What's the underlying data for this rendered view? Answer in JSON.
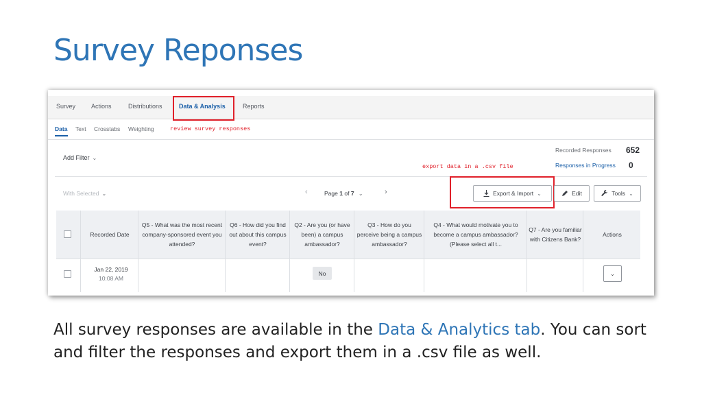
{
  "slide": {
    "title": "Survey Reponses",
    "caption_part1": "All survey responses are available in the ",
    "caption_link": "Data & Analytics tab",
    "caption_part2": ". You can sort and filter the responses and export them in a .csv file as well."
  },
  "app": {
    "topnav": [
      "Survey",
      "Actions",
      "Distributions",
      "Data & Analysis",
      "Reports"
    ],
    "active_topnav": "Data & Analysis",
    "subnav": [
      "Data",
      "Text",
      "Crosstabs",
      "Weighting"
    ],
    "active_subnav": "Data",
    "annotation_review": "review survey responses",
    "annotation_export": "export data in a .csv file",
    "add_filter": "Add Filter",
    "recorded_responses_label": "Recorded Responses",
    "recorded_responses_value": "652",
    "in_progress_label": "Responses in Progress",
    "in_progress_value": "0",
    "with_selected": "With Selected",
    "page_label": "Page",
    "page_current": "1",
    "page_of": "of",
    "page_total": "7",
    "export_button": "Export & Import",
    "edit_button": "Edit",
    "tools_button": "Tools",
    "columns": [
      "Recorded Date",
      "Q5 - What was the most recent company-sponsored event you attended?",
      "Q6 - How did you find out about this campus event?",
      "Q2 - Are you (or have been) a campus ambassador?",
      "Q3 - How do you perceive being a campus ambassador?",
      "Q4 - What would motivate you to become a campus ambassador? (Please select all t...",
      "Q7 - Are you familiar with Citizens Bank?",
      "Actions"
    ],
    "rows": [
      {
        "date": "Jan 22, 2019",
        "time": "10:08 AM",
        "q2": "No"
      }
    ]
  },
  "colors": {
    "accent": "#2e75b6",
    "highlight": "#e0202a",
    "link": "#1a5fa8"
  },
  "icons": [
    "download-icon",
    "pencil-icon",
    "wrench-icon",
    "chevron-down-icon",
    "chevron-left-icon",
    "chevron-right-icon"
  ]
}
